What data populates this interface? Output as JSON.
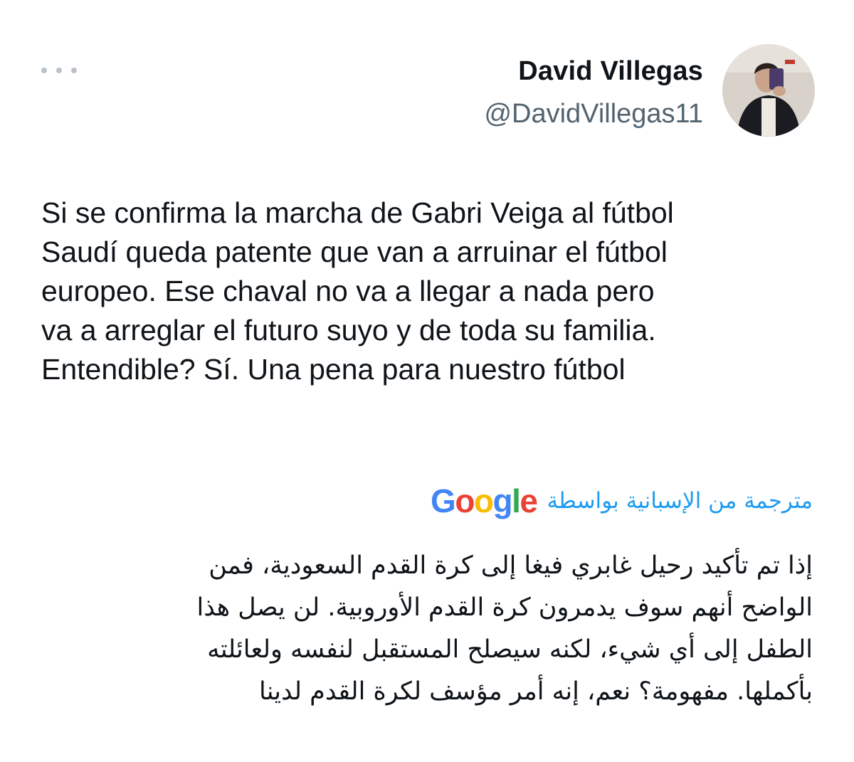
{
  "author": {
    "name": "David Villegas",
    "handle": "@DavidVillegas11",
    "avatar_icon": "profile-photo"
  },
  "more_icon": "more-horizontal-icon",
  "tweet": {
    "text": "Si se confirma la marcha de Gabri Veiga al fútbol\nSaudí queda patente que van a arruinar el fútbol\neuropeo. Ese chaval no va a llegar a nada pero\nva a arreglar el futuro suyo y de toda su familia.\nEntendible? Sí. Una pena para nuestro fútbol"
  },
  "translation": {
    "label": "مترجمة من الإسبانية بواسطة",
    "provider": "Google",
    "text": "إذا تم تأكيد رحيل غابري فيغا إلى كرة القدم السعودية، فمن\nالواضح أنهم سوف يدمرون كرة القدم الأوروبية. لن يصل هذا\nالطفل إلى أي شيء، لكنه سيصلح المستقبل لنفسه ولعائلته\nبأكملها. مفهومة؟ نعم، إنه أمر مؤسف لكرة القدم لدينا"
  },
  "colors": {
    "text": "#0f1419",
    "secondary": "#536471",
    "link": "#1d9bf0",
    "dots": "#b9c1c8"
  }
}
